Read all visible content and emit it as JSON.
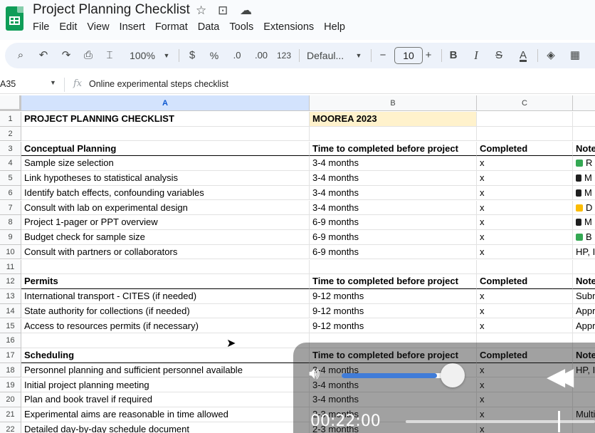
{
  "app": {
    "title": "Project Planning Checklist",
    "menu": [
      "File",
      "Edit",
      "View",
      "Insert",
      "Format",
      "Data",
      "Tools",
      "Extensions",
      "Help"
    ]
  },
  "toolbar": {
    "zoom": "100%",
    "currency": "$",
    "percent": "%",
    "dec_decrease": ".0",
    "dec_increase": ".00",
    "number_format": "123",
    "font": "Defaul...",
    "font_size": "10",
    "bold": "B",
    "italic": "I",
    "strike": "S",
    "text_color": "A",
    "minus": "−",
    "plus": "+"
  },
  "formula_bar": {
    "name_box": "A35",
    "fx": "fx",
    "content": "Online experimental steps checklist"
  },
  "columns": [
    "A",
    "B",
    "C"
  ],
  "rows": [
    {
      "n": "1",
      "a": "PROJECT PLANNING CHECKLIST",
      "b": "MOOREA 2023",
      "c": "",
      "d": "",
      "style": "title"
    },
    {
      "n": "2",
      "a": "",
      "b": "",
      "c": "",
      "d": ""
    },
    {
      "n": "3",
      "a": "Conceptual Planning",
      "b": "Time to completed before project",
      "c": "Completed",
      "d": "Note",
      "style": "hdr"
    },
    {
      "n": "4",
      "a": "Sample size selection",
      "b": "3-4 months",
      "c": "x",
      "d": "R",
      "chip": "g"
    },
    {
      "n": "5",
      "a": "Link hypotheses to statistical analysis",
      "b": "3-4 months",
      "c": "x",
      "d": "M",
      "chip": "d"
    },
    {
      "n": "6",
      "a": "Identify batch effects, confounding variables",
      "b": "3-4 months",
      "c": "x",
      "d": "M",
      "chip": "d"
    },
    {
      "n": "7",
      "a": "Consult with lab on experimental design",
      "b": "3-4 months",
      "c": "x",
      "d": "D",
      "chip": "y"
    },
    {
      "n": "8",
      "a": "Project 1-pager or PPT overview",
      "b": "6-9 months",
      "c": "x",
      "d": "M",
      "chip": "d"
    },
    {
      "n": "9",
      "a": "Budget check for sample size",
      "b": "6-9 months",
      "c": "x",
      "d": "B",
      "chip": "g"
    },
    {
      "n": "10",
      "a": "Consult with partners or collaborators",
      "b": "6-9 months",
      "c": "x",
      "d": "HP, I"
    },
    {
      "n": "11",
      "a": "",
      "b": "",
      "c": "",
      "d": ""
    },
    {
      "n": "12",
      "a": "Permits",
      "b": "Time to completed before project",
      "c": "Completed",
      "d": "Note",
      "style": "hdr"
    },
    {
      "n": "13",
      "a": "International transport - CITES (if needed)",
      "b": "9-12 months",
      "c": "x",
      "d": "Subm"
    },
    {
      "n": "14",
      "a": "State authority for collections (if needed)",
      "b": "9-12 months",
      "c": "x",
      "d": "Appr"
    },
    {
      "n": "15",
      "a": "Access to resources permits (if necessary)",
      "b": "9-12 months",
      "c": "x",
      "d": "Appr"
    },
    {
      "n": "16",
      "a": "",
      "b": "",
      "c": "",
      "d": ""
    },
    {
      "n": "17",
      "a": "Scheduling",
      "b": "Time to completed before project",
      "c": "Completed",
      "d": "Note",
      "style": "hdr"
    },
    {
      "n": "18",
      "a": "Personnel planning and sufficient personnel available",
      "b": "3-4 months",
      "c": "x",
      "d": "HP, I"
    },
    {
      "n": "19",
      "a": "Initial project planning meeting",
      "b": "3-4 months",
      "c": "x",
      "d": ""
    },
    {
      "n": "20",
      "a": "Plan and book travel if required",
      "b": "3-4 months",
      "c": "x",
      "d": ""
    },
    {
      "n": "21",
      "a": "Experimental aims are reasonable in time allowed",
      "b": "2-3 months",
      "c": "x",
      "d": "Multi"
    },
    {
      "n": "22",
      "a": "Detailed day-by-day schedule document",
      "b": "2-3 months",
      "c": "x",
      "d": ""
    }
  ],
  "video": {
    "time": "00:22:00",
    "volume": 0.85,
    "progress": 0.8
  }
}
